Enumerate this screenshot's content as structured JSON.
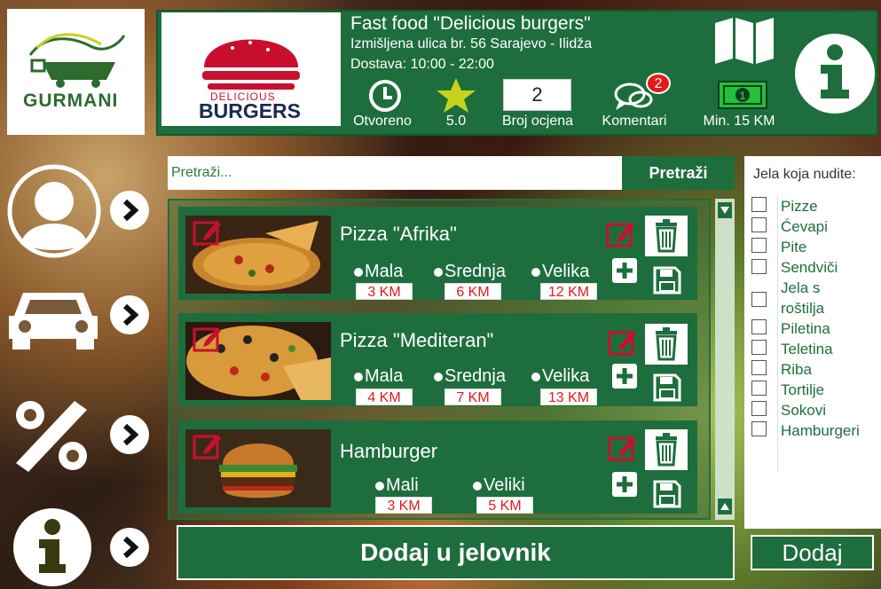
{
  "app": {
    "logo_text": "GURMANI"
  },
  "restaurant": {
    "logo_text_top": "DELICIOUS",
    "logo_text_bottom": "BURGERS",
    "title": "Fast food  \"Delicious burgers\"",
    "address": "Izmišljena ulica br. 56 Sarajevo - Ilidža",
    "delivery": "Dostava: 10:00 - 22:00",
    "status_label": "Otvoreno",
    "rating_value": "5.0",
    "rating_count": "2",
    "rating_count_label": "Broj ocjena",
    "comments_badge": "2",
    "comments_label": "Komentari",
    "min_order_label": "Min. 15 KM"
  },
  "search": {
    "placeholder": "Pretraži...",
    "button_label": "Pretraži"
  },
  "items": [
    {
      "name": "Pizza \"Afrika\"",
      "sizes": [
        "Mala",
        "Srednja",
        "Velika"
      ],
      "prices": [
        "3 KM",
        "6 KM",
        "12 KM"
      ]
    },
    {
      "name": "Pizza \"Mediteran\"",
      "sizes": [
        "Mala",
        "Srednja",
        "Velika"
      ],
      "prices": [
        "4 KM",
        "7 KM",
        "13 KM"
      ]
    },
    {
      "name": "Hamburger",
      "sizes": [
        "Mali",
        "Veliki"
      ],
      "prices": [
        "3 KM",
        "5 KM"
      ]
    }
  ],
  "add_to_menu_label": "Dodaj u jelovnik",
  "categories": {
    "title": "Jela koja nudite:",
    "items": [
      "Pizze",
      "Ćevapi",
      "Pite",
      "Sendviči",
      "Jela s roštilja",
      "Piletina",
      "Teletina",
      "Riba",
      "Tortilje",
      "Sokovi",
      "Hamburgeri"
    ]
  },
  "add_label": "Dodaj",
  "colors": {
    "primary": "#1e6e3d",
    "price": "#e21b1b",
    "badge": "#e21b1b",
    "money": "#22c13a",
    "star": "#c8d21e"
  }
}
